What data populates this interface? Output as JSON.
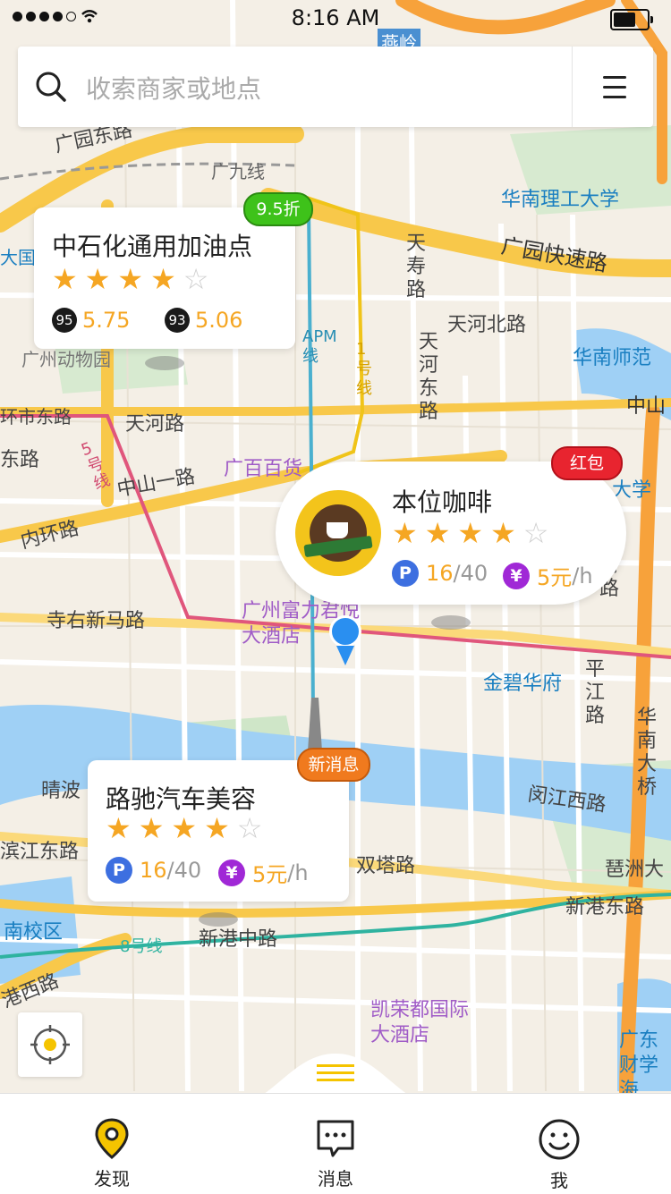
{
  "status_bar": {
    "time": "8:16 AM"
  },
  "search": {
    "placeholder": "收索商家或地点"
  },
  "map_labels": {
    "guangyuan_east": "广园东路",
    "guangjiu": "广九线",
    "scut": "华南理工大学",
    "guangyuan_express": "广园快速路",
    "tianshou": "天寿路",
    "tianhe_north": "天河北路",
    "tianhe_east": "天河东路",
    "zoo": "广州动物园",
    "apm": "APM线",
    "line1": "1号线",
    "huanshi": "环市东路",
    "tianhe_rd": "天河路",
    "dong_rd": "东路",
    "line5": "5号线",
    "zhongshan_yi": "中山一路",
    "guangbai": "广百百货",
    "neihuan": "内环路",
    "siyou": "寺右新马路",
    "fulijun": "广州富力君悦大酒店",
    "jinbi": "金碧华府",
    "pingjiang": "平江路",
    "huanan_bridge": "华南大桥",
    "qingbo": "晴波",
    "minjiang_west": "闵江西路",
    "binjiang_east": "滨江东路",
    "shuangta": "双塔路",
    "pizhou": "琶洲大",
    "xingang_east": "新港东路",
    "south_campus": "南校区",
    "line8": "8号线",
    "xingang_mid": "新港中路",
    "xingang_west": "港西路",
    "kairong": "凯荣都国际大酒店",
    "gdufe": "广东财学海",
    "yanling": "燕岭",
    "scnu": "华南师范",
    "zhongshan": "中山",
    "daxue": "大学",
    "cuncun": "村路",
    "dong_guo": "大国"
  },
  "cards": {
    "gas": {
      "tag": "9.5折",
      "title": "中石化通用加油点",
      "rating": 4,
      "fuel": [
        {
          "grade": "95",
          "price": "5.75"
        },
        {
          "grade": "93",
          "price": "5.06"
        }
      ]
    },
    "coffee": {
      "tag": "红包",
      "title": "本位咖啡",
      "rating": 4,
      "parking_used": "16",
      "parking_total": "/40",
      "price": "5元",
      "price_unit": "/h",
      "logo_text": "The Java Stop!"
    },
    "car": {
      "tag": "新消息",
      "title": "路驰汽车美容",
      "rating": 4,
      "parking_used": "16",
      "parking_total": "/40",
      "price": "5元",
      "price_unit": "/h"
    }
  },
  "badges": {
    "parking": "P",
    "yuan": "¥"
  },
  "tabs": [
    {
      "label": "发现"
    },
    {
      "label": "消息"
    },
    {
      "label": "我"
    }
  ],
  "colors": {
    "accent": "#f5c400",
    "star_on": "#f5a623",
    "parking_badge": "#3d6fe0",
    "yuan_badge": "#a028d6",
    "map_bg": "#f4efe6",
    "water": "#9fd0f5",
    "road_major": "#f8c84a"
  }
}
